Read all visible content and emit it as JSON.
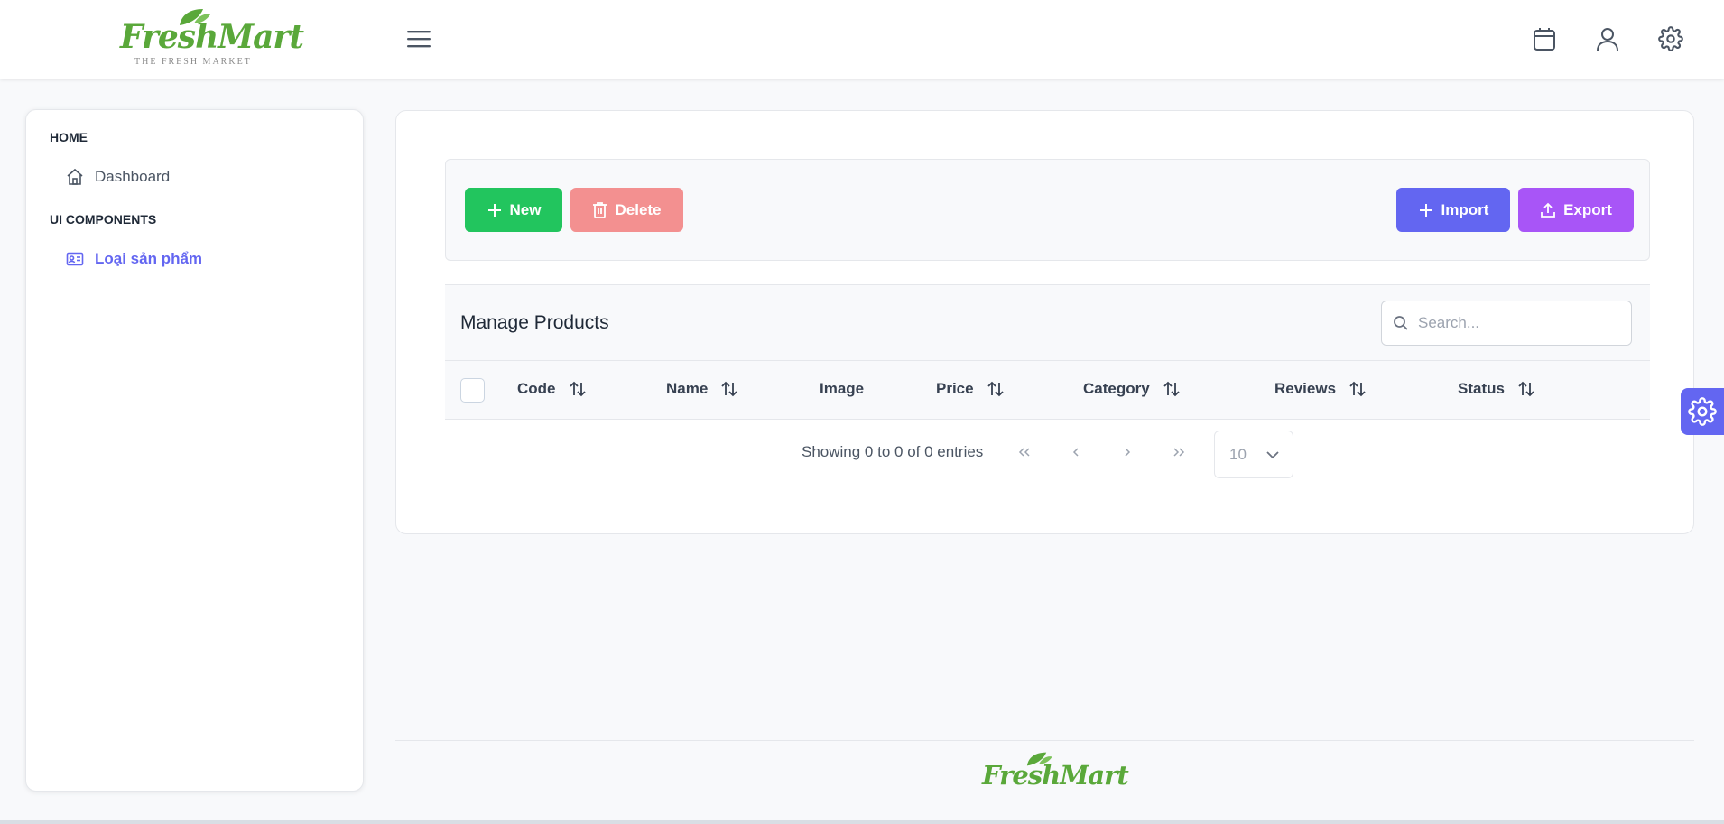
{
  "brand": {
    "logo_text": "FreshMart",
    "logo_subtitle": "THE FRESH MARKET",
    "accent": "#5aa83a"
  },
  "header": {
    "menu_icon": "hamburger-icon",
    "icons": [
      "calendar-icon",
      "user-icon",
      "gear-icon"
    ]
  },
  "sidebar": {
    "sections": [
      {
        "label": "HOME",
        "items": [
          {
            "label": "Dashboard",
            "icon": "home-icon"
          }
        ]
      },
      {
        "label": "UI COMPONENTS",
        "items": [
          {
            "label": "Loại sản phẩm",
            "icon": "id-card-icon",
            "active": true
          }
        ]
      }
    ],
    "active_color": "#6366f1"
  },
  "toolbar": {
    "new_label": "New",
    "delete_label": "Delete",
    "import_label": "Import",
    "export_label": "Export",
    "colors": {
      "new": "#22c55e",
      "delete": "#f39090",
      "import": "#6366f1",
      "export": "#a855f7"
    }
  },
  "table": {
    "title": "Manage Products",
    "search_placeholder": "Search...",
    "columns": [
      {
        "label": "Code",
        "sortable": true
      },
      {
        "label": "Name",
        "sortable": true
      },
      {
        "label": "Image",
        "sortable": false
      },
      {
        "label": "Price",
        "sortable": true
      },
      {
        "label": "Category",
        "sortable": true
      },
      {
        "label": "Reviews",
        "sortable": true
      },
      {
        "label": "Status",
        "sortable": true
      }
    ],
    "rows": []
  },
  "pagination": {
    "info": "Showing 0 to 0 of 0 entries",
    "rows_per_page": "10"
  },
  "footer": {
    "logo_text": "FreshMart"
  }
}
